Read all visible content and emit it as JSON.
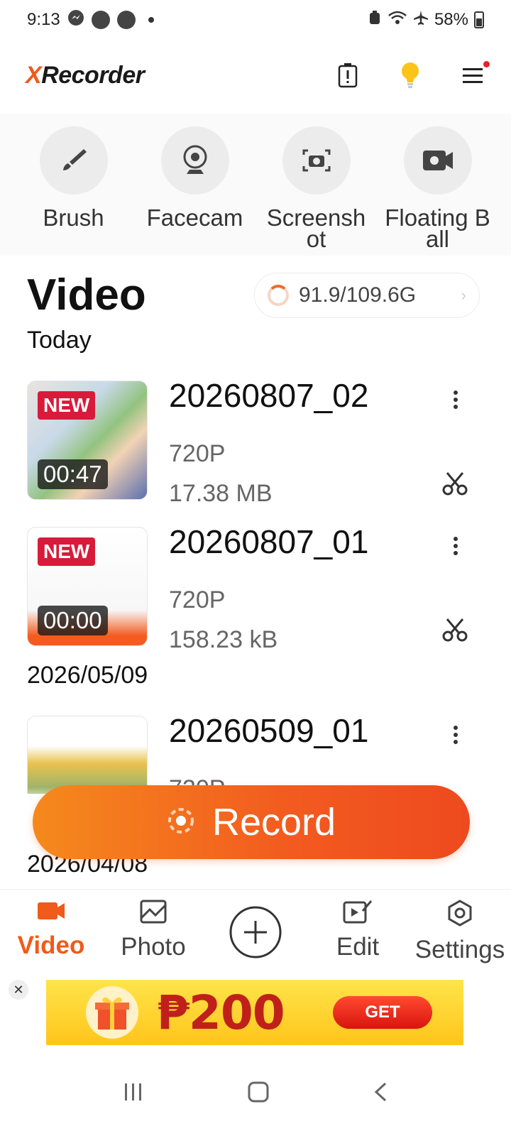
{
  "status_bar": {
    "time": "9:13",
    "battery": "58%"
  },
  "header": {
    "logo_prefix": "X",
    "logo_text": "Recorder"
  },
  "tools": [
    {
      "label": "Brush",
      "icon": "brush-icon"
    },
    {
      "label": "Facecam",
      "icon": "facecam-icon"
    },
    {
      "label": "Screenshot",
      "icon": "camera-icon"
    },
    {
      "label": "Floating Ball",
      "icon": "floating-ball-icon"
    }
  ],
  "section": {
    "title": "Video",
    "storage": "91.9/109.6G"
  },
  "groups": [
    {
      "date": "Today",
      "videos": [
        {
          "title": "20260807_02",
          "resolution": "720P",
          "size": "17.38 MB",
          "badge": "NEW",
          "duration": "00:47"
        },
        {
          "title": "20260807_01",
          "resolution": "720P",
          "size": "158.23 kB",
          "badge": "NEW",
          "duration": "00:00"
        }
      ]
    },
    {
      "date": "2026/05/09",
      "videos": [
        {
          "title": "20260509_01",
          "resolution": "720P"
        }
      ]
    },
    {
      "date": "2026/04/08",
      "videos": []
    }
  ],
  "record_button": {
    "label": "Record"
  },
  "bottom_nav": [
    {
      "label": "Video",
      "icon": "video-camera-icon",
      "active": true
    },
    {
      "label": "Photo",
      "icon": "photo-icon",
      "active": false
    },
    {
      "label": "",
      "icon": "add-circle-icon",
      "active": false
    },
    {
      "label": "Edit",
      "icon": "edit-icon",
      "active": false
    },
    {
      "label": "Settings",
      "icon": "gear-icon",
      "active": false
    }
  ],
  "ad": {
    "amount": "₱200",
    "cta": "GET"
  },
  "colors": {
    "accent": "#f05a1a",
    "new_badge": "#d81b3a",
    "ad_yellow": "#ffd23a"
  }
}
